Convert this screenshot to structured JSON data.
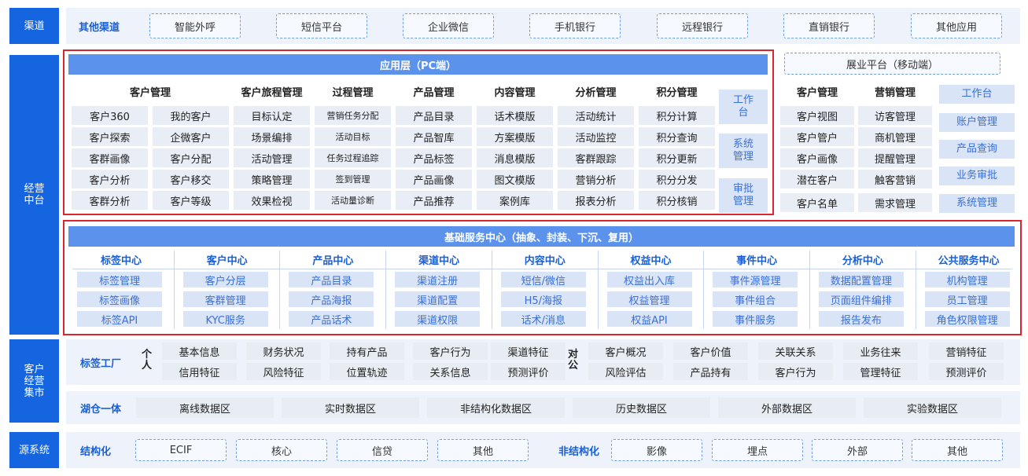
{
  "sides": {
    "channel": "渠道",
    "ops": "经营\n中台",
    "market": "客户\n经营\n集市",
    "source": "源系统"
  },
  "channel": {
    "label": "其他渠道",
    "items": [
      "智能外呼",
      "短信平台",
      "企业微信",
      "手机银行",
      "远程银行",
      "直销银行",
      "其他应用"
    ]
  },
  "app": {
    "title": "应用层（PC端）",
    "columns": [
      {
        "header": "客户管理",
        "cells": [
          "客户360",
          "客户探索",
          "客群画像",
          "客户分析",
          "客群分析"
        ]
      },
      {
        "header": "",
        "cells": [
          "我的客户",
          "企微客户",
          "客户分配",
          "客户移交",
          "客户等级"
        ]
      },
      {
        "header": "客户旅程管理",
        "cells": [
          "目标认定",
          "场景编排",
          "活动管理",
          "策略管理",
          "效果检视"
        ]
      },
      {
        "header": "过程管理",
        "cells": [
          "营销任务分配",
          "活动目标",
          "任务过程追踪",
          "签到管理",
          "活动量诊断"
        ]
      },
      {
        "header": "产品管理",
        "cells": [
          "产品目录",
          "产品智库",
          "产品标签",
          "产品画像",
          "产品推荐"
        ]
      },
      {
        "header": "内容管理",
        "cells": [
          "话术模版",
          "方案模版",
          "消息模版",
          "图文模版",
          "案例库"
        ]
      },
      {
        "header": "分析管理",
        "cells": [
          "活动统计",
          "活动监控",
          "客群跟踪",
          "营销分析",
          "报表分析"
        ]
      },
      {
        "header": "积分管理",
        "cells": [
          "积分计算",
          "积分查询",
          "积分更新",
          "积分分发",
          "积分核销"
        ]
      }
    ],
    "side_buttons": [
      "工作\n台",
      "系统\n管理",
      "审批\n管理"
    ]
  },
  "mobile": {
    "title": "展业平台（移动端）",
    "columns": [
      {
        "header": "客户管理",
        "cells": [
          "客户视图",
          "客户管户",
          "客户画像",
          "潜在客户",
          "客户名单"
        ]
      },
      {
        "header": "营销管理",
        "cells": [
          "访客管理",
          "商机管理",
          "提醒管理",
          "触客营销",
          "需求管理"
        ]
      }
    ],
    "side_buttons": [
      "工作台",
      "账户管理",
      "产品查询",
      "业务审批",
      "系统管理"
    ]
  },
  "base": {
    "title": "基础服务中心（抽象、封装、下沉、复用）",
    "columns": [
      {
        "header": "标签中心",
        "items": [
          "标签管理",
          "标签画像",
          "标签API"
        ]
      },
      {
        "header": "客户中心",
        "items": [
          "客户分层",
          "客群管理",
          "KYC服务"
        ]
      },
      {
        "header": "产品中心",
        "items": [
          "产品目录",
          "产品海报",
          "产品话术"
        ]
      },
      {
        "header": "渠道中心",
        "items": [
          "渠道注册",
          "渠道配置",
          "渠道权限"
        ]
      },
      {
        "header": "内容中心",
        "items": [
          "短信/微信",
          "H5/海报",
          "话术/消息"
        ]
      },
      {
        "header": "权益中心",
        "items": [
          "权益出入库",
          "权益管理",
          "权益API"
        ]
      },
      {
        "header": "事件中心",
        "items": [
          "事件源管理",
          "事件组合",
          "事件服务"
        ]
      },
      {
        "header": "分析中心",
        "items": [
          "数据配置管理",
          "页面组件编排",
          "报告发布"
        ]
      },
      {
        "header": "公共服务中心",
        "items": [
          "机构管理",
          "员工管理",
          "角色权限管理"
        ]
      }
    ]
  },
  "tagfactory": {
    "label": "标签工厂",
    "personal": "个\n人",
    "corporate": "对\n公",
    "personal_row1": [
      "基本信息",
      "财务状况",
      "持有产品",
      "客户行为",
      "渠道特征"
    ],
    "personal_row2": [
      "信用特征",
      "风险特征",
      "位置轨迹",
      "关系信息",
      "预测评价"
    ],
    "corp_row1": [
      "客户概况",
      "客户价值",
      "关联关系",
      "业务往来",
      "营销特征"
    ],
    "corp_row2": [
      "风险评估",
      "产品持有",
      "客户行为",
      "管理特征",
      "预测评价"
    ]
  },
  "lake": {
    "label": "湖仓一体",
    "items": [
      "离线数据区",
      "实时数据区",
      "非结构化数据区",
      "历史数据区",
      "外部数据区",
      "实验数据区"
    ]
  },
  "source": {
    "structured_label": "结构化",
    "structured": [
      "ECIF",
      "核心",
      "信贷",
      "其他"
    ],
    "unstructured_label": "非结构化",
    "unstructured": [
      "影像",
      "埋点",
      "外部",
      "其他"
    ]
  },
  "colors": {
    "primary": "#1565e0",
    "bar": "#5b93ec",
    "highlight": "#d9252b"
  }
}
